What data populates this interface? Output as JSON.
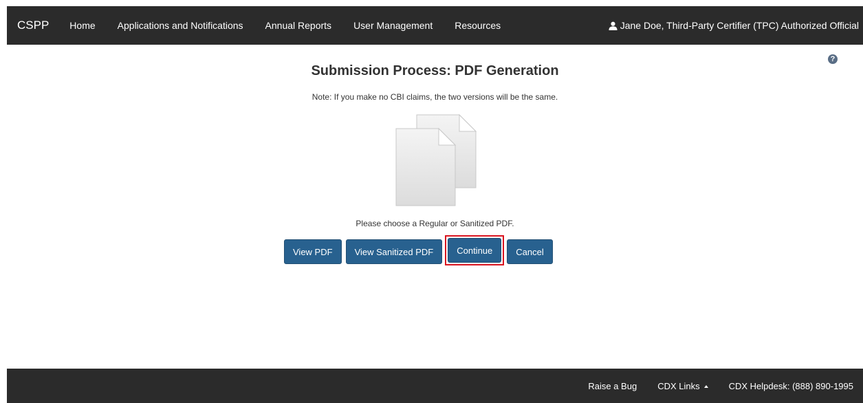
{
  "navbar": {
    "brand": "CSPP",
    "items": [
      {
        "label": "Home"
      },
      {
        "label": "Applications and Notifications"
      },
      {
        "label": "Annual Reports"
      },
      {
        "label": "User Management"
      },
      {
        "label": "Resources"
      }
    ],
    "user": {
      "icon": "user-icon",
      "label": "Jane Doe, Third-Party Certifier (TPC) Authorized Official"
    }
  },
  "help": {
    "icon": "help-icon",
    "glyph": "?"
  },
  "main": {
    "title": "Submission Process: PDF Generation",
    "note": "Note: If you make no CBI claims, the two versions will be the same.",
    "graphic_icon": "documents-icon",
    "choose_text": "Please choose a Regular or Sanitized PDF.",
    "buttons": {
      "view_pdf": "View PDF",
      "view_sanitized_pdf": "View Sanitized PDF",
      "continue": "Continue",
      "cancel": "Cancel"
    }
  },
  "footer": {
    "raise_bug": "Raise a Bug",
    "cdx_links": "CDX Links",
    "helpdesk": "CDX Helpdesk: (888) 890-1995"
  },
  "colors": {
    "navbar_bg": "#2b2b2b",
    "button_bg": "#28618f",
    "highlight": "#d9141f",
    "help_icon": "#5a6e86"
  }
}
